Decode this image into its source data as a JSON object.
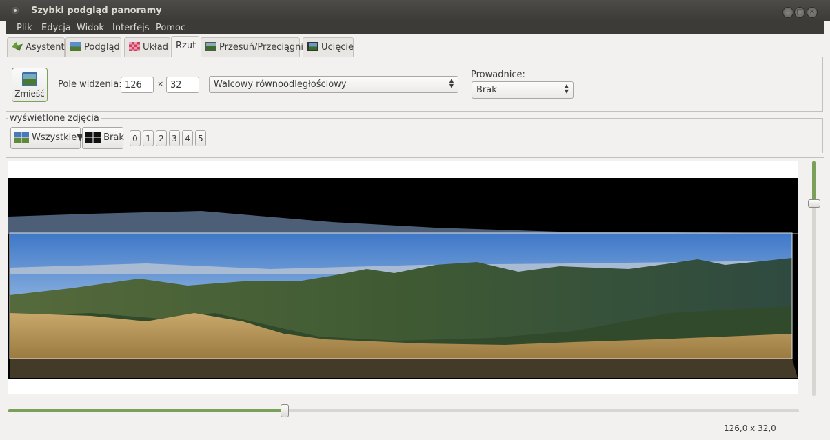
{
  "window": {
    "title": "Szybki podgląd panoramy"
  },
  "menu": {
    "items": [
      "Plik",
      "Edycja",
      "Widok",
      "Interfejs",
      "Pomoc"
    ]
  },
  "tabs": [
    {
      "label": "Asystent",
      "icon": "assistant-icon"
    },
    {
      "label": "Podgląd",
      "icon": "preview-icon"
    },
    {
      "label": "Układ",
      "icon": "layout-icon"
    },
    {
      "label": "Rzut",
      "icon": "",
      "active": true
    },
    {
      "label": "Przesuń/Przeciągnij",
      "icon": "move-drag-icon"
    },
    {
      "label": "Ucięcie",
      "icon": "crop-icon"
    }
  ],
  "projection": {
    "fit_label": "Zmieść",
    "fov_label": "Pole widzenia:",
    "fov_h": "126",
    "times": "×",
    "fov_v": "32",
    "projection_value": "Walcowy równoodległościowy",
    "guides_label": "Prowadnice:",
    "guides_value": "Brak"
  },
  "displayed": {
    "group_label": "wyświetlone zdjęcia",
    "all_label": "Wszystkie",
    "all_arrow": "▼",
    "none_label": "Brak",
    "numbers": [
      "0",
      "1",
      "2",
      "3",
      "4",
      "5"
    ]
  },
  "sliders": {
    "vertical_level": 0.18,
    "horizontal_level": 0.35
  },
  "status": {
    "text": "126,0 x 32,0"
  },
  "colors": {
    "accent": "#7aa05a",
    "titlebar": "#3c3b37"
  }
}
